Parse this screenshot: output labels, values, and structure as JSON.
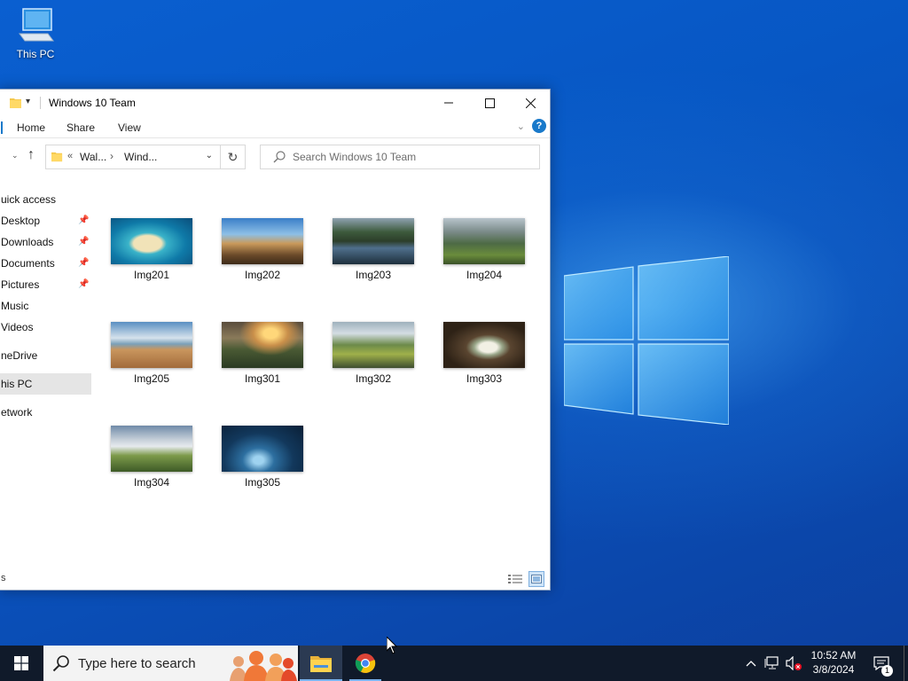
{
  "desktop": {
    "this_pc_label": "This PC"
  },
  "window": {
    "title": "Windows 10 Team",
    "ribbon_tabs": [
      "Home",
      "Share",
      "View"
    ],
    "address": {
      "crumb1": "Wal...",
      "crumb2": "Wind...",
      "back_glyph": "«"
    },
    "search_placeholder": "Search Windows 10 Team",
    "status_text": "s",
    "sidebar": [
      {
        "label": "uick access",
        "pinned": false
      },
      {
        "label": "Desktop",
        "pinned": true
      },
      {
        "label": "Downloads",
        "pinned": true
      },
      {
        "label": "Documents",
        "pinned": true
      },
      {
        "label": "Pictures",
        "pinned": true
      },
      {
        "label": "Music",
        "pinned": false
      },
      {
        "label": "Videos",
        "pinned": false
      },
      {
        "label": "neDrive",
        "pinned": false
      },
      {
        "label": "his PC",
        "pinned": false,
        "selected": true
      },
      {
        "label": "etwork",
        "pinned": false
      }
    ],
    "files": [
      "Img201",
      "Img202",
      "Img203",
      "Img204",
      "Img205",
      "Img301",
      "Img302",
      "Img303",
      "Img304",
      "Img305"
    ]
  },
  "taskbar": {
    "search_text": "Type here to search",
    "time": "10:52 AM",
    "date": "3/8/2024",
    "notification_count": "1"
  },
  "colors": {
    "accent": "#1979ca",
    "taskbar": "#101a2a"
  }
}
